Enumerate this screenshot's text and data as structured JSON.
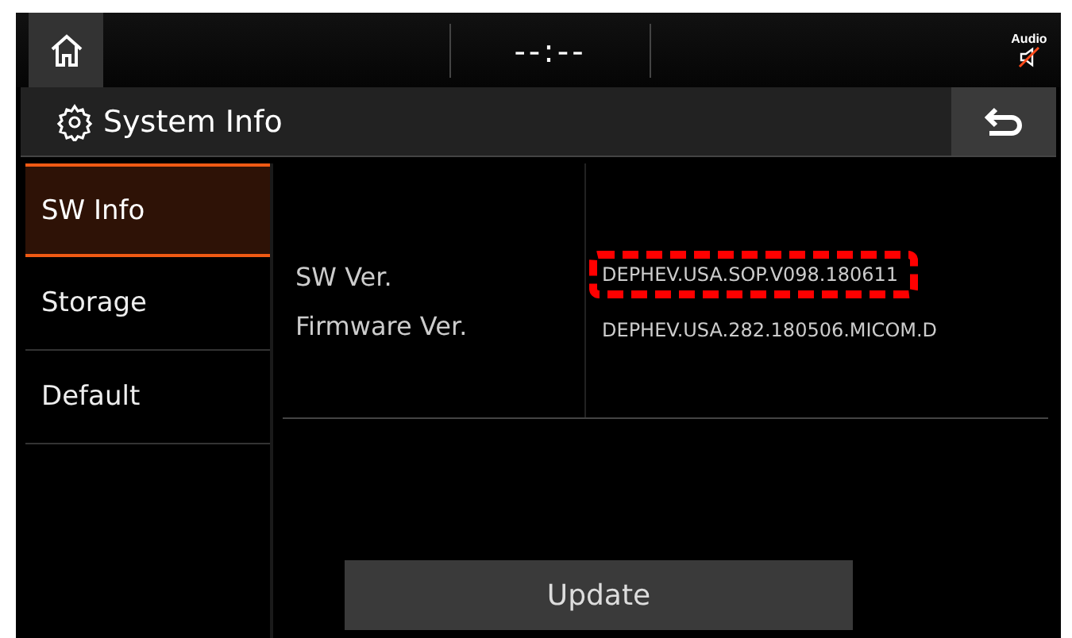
{
  "status_bar": {
    "clock": "--:--",
    "audio_label": "Audio",
    "audio_muted": true
  },
  "header": {
    "title": "System Info"
  },
  "sidebar": {
    "items": [
      {
        "label": "SW Info",
        "selected": true
      },
      {
        "label": "Storage",
        "selected": false
      },
      {
        "label": "Default",
        "selected": false
      }
    ]
  },
  "info_rows": [
    {
      "label": "SW Ver.",
      "value": "DEPHEV.USA.SOP.V098.180611",
      "highlighted": true
    },
    {
      "label": "Firmware Ver.",
      "value": "DEPHEV.USA.282.180506.MICOM.D",
      "highlighted": false
    }
  ],
  "update_button": "Update"
}
